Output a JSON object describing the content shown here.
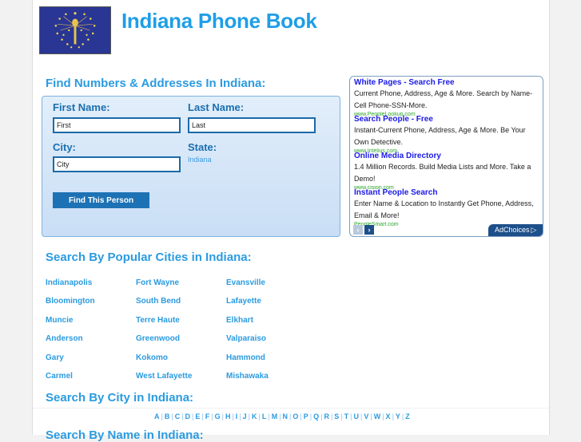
{
  "header": {
    "title": "Indiana Phone Book",
    "logo_icon": "indiana-flag-icon"
  },
  "search": {
    "heading": "Find Numbers & Addresses In Indiana:",
    "first_name_label": "First Name:",
    "first_name_value": "First",
    "last_name_label": "Last Name:",
    "last_name_value": "Last",
    "city_label": "City:",
    "city_value": "City",
    "state_label": "State:",
    "state_value": "Indiana",
    "submit_label": "Find This Person"
  },
  "ads": {
    "items": [
      {
        "title": "White Pages - Search Free",
        "text": "Current Phone, Address, Age & More. Search by Name-Cell Phone-SSN-More.",
        "url": "www.PeopleLookup.com"
      },
      {
        "title": "Search People - Free",
        "text": "Instant-Current Phone, Address, Age & More. Be Your Own Detective.",
        "url": "www.Intelius.com"
      },
      {
        "title": "Online Media Directory",
        "text": "1.4 Million Records. Build Media Lists and More. Take a Demo!",
        "url": "www.cision.com"
      },
      {
        "title": "Instant People Search",
        "text": "Enter Name & Location to Instantly Get Phone, Address, Email & More!",
        "url": "PeopleSmart.com"
      }
    ],
    "prev_icon": "chevron-left-icon",
    "next_icon": "chevron-right-icon",
    "adchoices_label": "AdChoices",
    "adchoices_icon": "play-triangle-icon"
  },
  "popular_cities": {
    "heading": "Search By Popular Cities in Indiana:",
    "columns": [
      [
        "Indianapolis",
        "Bloomington",
        "Muncie",
        "Anderson",
        "Gary",
        "Carmel"
      ],
      [
        "Fort Wayne",
        "South Bend",
        "Terre Haute",
        "Greenwood",
        "Kokomo",
        "West Lafayette"
      ],
      [
        "Evansville",
        "Lafayette",
        "Elkhart",
        "Valparaiso",
        "Hammond",
        "Mishawaka"
      ]
    ]
  },
  "city_search": {
    "heading": "Search By City in Indiana:",
    "letters": [
      "A",
      "B",
      "C",
      "D",
      "E",
      "F",
      "G",
      "H",
      "I",
      "J",
      "K",
      "L",
      "M",
      "N",
      "O",
      "P",
      "Q",
      "R",
      "S",
      "T",
      "U",
      "V",
      "W",
      "X",
      "Y",
      "Z"
    ]
  },
  "name_search": {
    "heading": "Search By Name in Indiana:"
  }
}
